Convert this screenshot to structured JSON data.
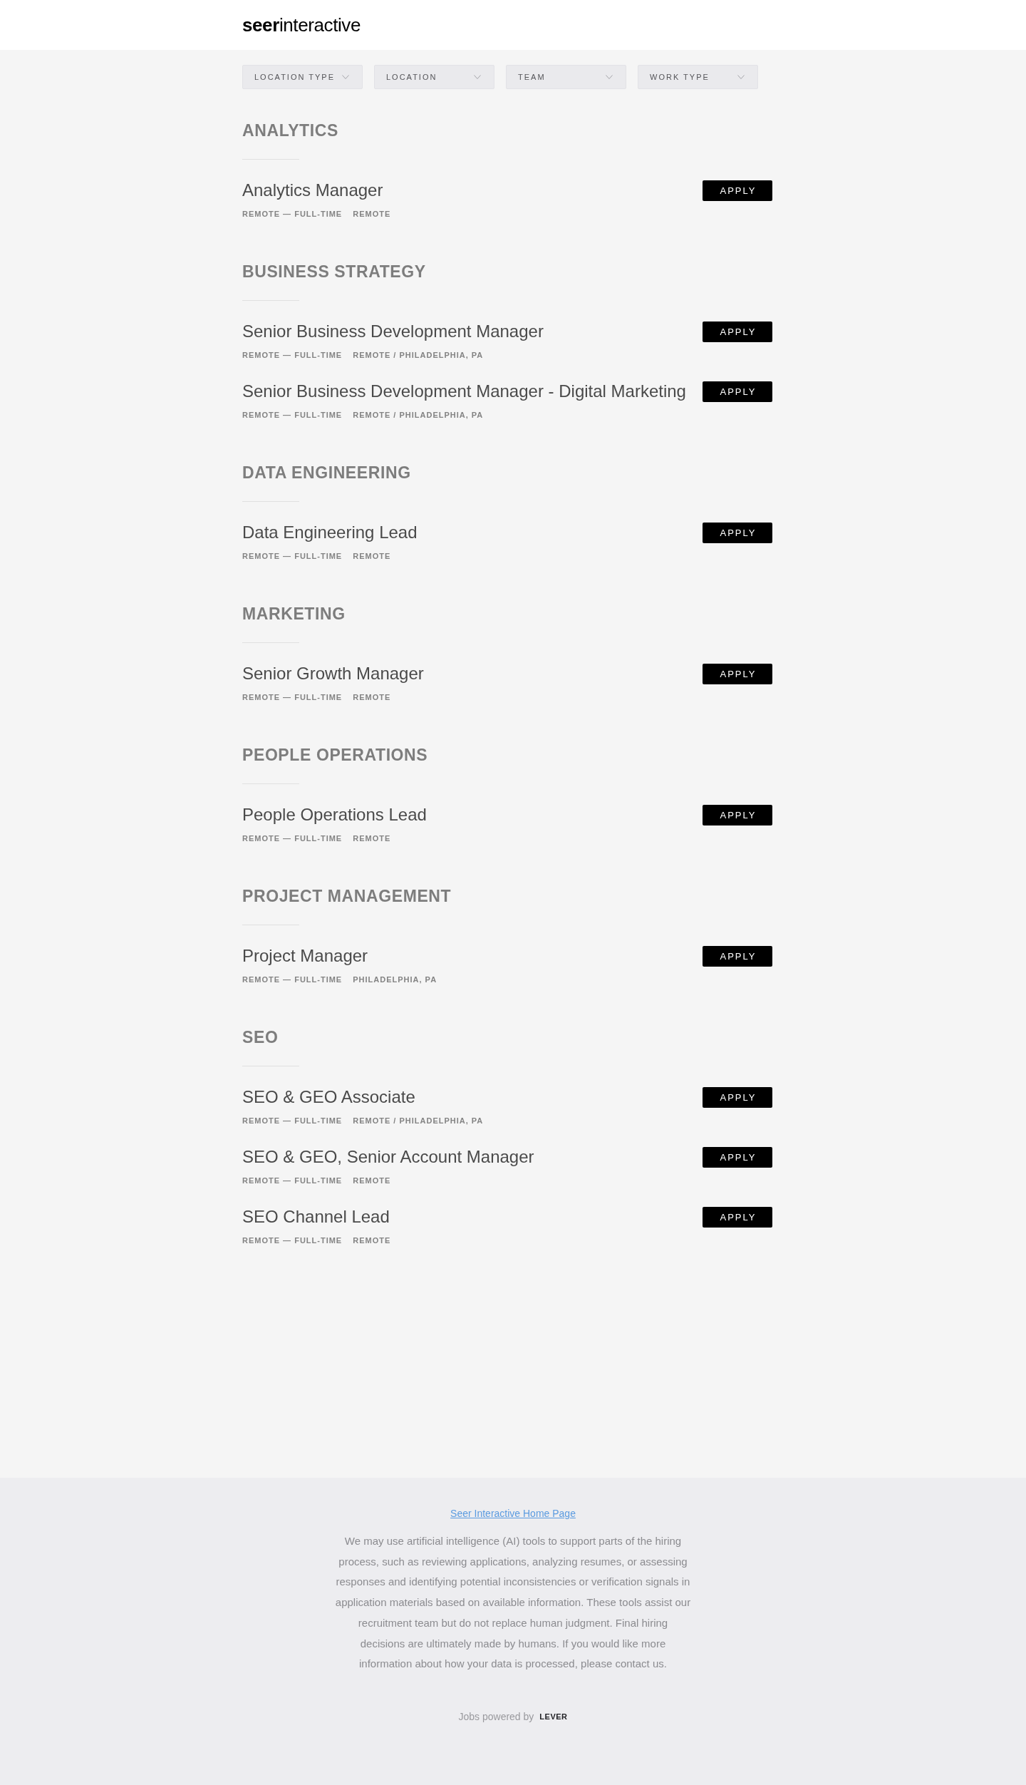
{
  "header": {
    "logo": "**seer**interactive"
  },
  "filters": [
    {
      "label": "LOCATION TYPE"
    },
    {
      "label": "LOCATION"
    },
    {
      "label": "TEAM"
    },
    {
      "label": "WORK TYPE"
    }
  ],
  "sections": [
    {
      "heading": "ANALYTICS",
      "jobs": [
        {
          "title": "Analytics Manager",
          "commitment": "REMOTE — FULL-TIME",
          "location": "REMOTE",
          "button": "APPLY"
        }
      ]
    },
    {
      "heading": "BUSINESS STRATEGY",
      "jobs": [
        {
          "title": "Senior Business Development Manager",
          "commitment": "REMOTE — FULL-TIME",
          "location": "REMOTE / PHILADELPHIA, PA",
          "button": "APPLY"
        },
        {
          "title": "Senior Business Development Manager - Digital Marketing",
          "commitment": "REMOTE — FULL-TIME",
          "location": "REMOTE / PHILADELPHIA, PA",
          "button": "APPLY"
        }
      ]
    },
    {
      "heading": "DATA ENGINEERING",
      "jobs": [
        {
          "title": "Data Engineering Lead",
          "commitment": "REMOTE — FULL-TIME",
          "location": "REMOTE",
          "button": "APPLY"
        }
      ]
    },
    {
      "heading": "MARKETING",
      "jobs": [
        {
          "title": "Senior Growth Manager",
          "commitment": "REMOTE — FULL-TIME",
          "location": "REMOTE",
          "button": "APPLY"
        }
      ]
    },
    {
      "heading": "PEOPLE OPERATIONS",
      "jobs": [
        {
          "title": "People Operations Lead",
          "commitment": "REMOTE — FULL-TIME",
          "location": "REMOTE",
          "button": "APPLY"
        }
      ]
    },
    {
      "heading": "PROJECT MANAGEMENT",
      "jobs": [
        {
          "title": "Project Manager",
          "commitment": "REMOTE — FULL-TIME",
          "location": "PHILADELPHIA, PA",
          "button": "APPLY"
        }
      ]
    },
    {
      "heading": "SEO",
      "jobs": [
        {
          "title": "SEO & GEO Associate",
          "commitment": "REMOTE — FULL-TIME",
          "location": "REMOTE / PHILADELPHIA, PA",
          "button": "APPLY"
        },
        {
          "title": "SEO & GEO, Senior Account Manager",
          "commitment": "REMOTE — FULL-TIME",
          "location": "REMOTE",
          "button": "APPLY"
        },
        {
          "title": "SEO Channel Lead",
          "commitment": "REMOTE — FULL-TIME",
          "location": "REMOTE",
          "button": "APPLY"
        }
      ]
    }
  ],
  "footer": {
    "link": "Seer Interactive Home Page",
    "notice": "We may use artificial intelligence (AI) tools to support parts of the hiring process, such as reviewing applications, analyzing resumes, or assessing responses and identifying potential inconsistencies or verification signals in application materials based on available information. These tools assist our recruitment team but do not replace human judgment. Final hiring decisions are ultimately made by humans. If you would like more information about how your data is processed, please contact us.",
    "powered_by": "Jobs powered by",
    "powered_by_logo": "LEVER"
  }
}
